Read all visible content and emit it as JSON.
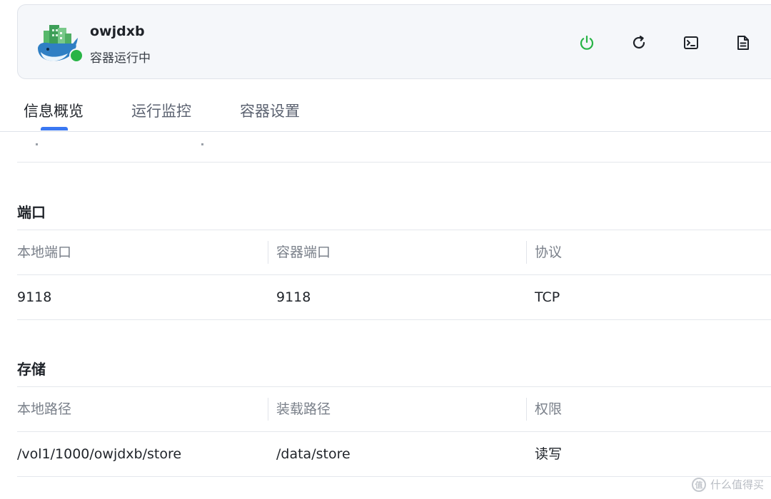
{
  "header": {
    "app_name": "owjdxb",
    "status_text": "容器运行中",
    "status_color": "#28b446",
    "actions": [
      {
        "name": "power-icon",
        "color": "#28b446"
      },
      {
        "name": "restart-icon",
        "color": "#1f2329"
      },
      {
        "name": "terminal-icon",
        "color": "#1f2329"
      },
      {
        "name": "log-document-icon",
        "color": "#1f2329"
      }
    ]
  },
  "tabs": [
    {
      "label": "信息概览",
      "active": true
    },
    {
      "label": "运行监控",
      "active": false
    },
    {
      "label": "容器设置",
      "active": false
    }
  ],
  "accent_color": "#3a78f2",
  "ports": {
    "title": "端口",
    "columns": [
      "本地端口",
      "容器端口",
      "协议"
    ],
    "rows": [
      [
        "9118",
        "9118",
        "TCP"
      ]
    ]
  },
  "storage": {
    "title": "存储",
    "columns": [
      "本地路径",
      "装载路径",
      "权限"
    ],
    "rows": [
      [
        "/vol1/1000/owjdxb/store",
        "/data/store",
        "读写"
      ]
    ]
  },
  "watermark": {
    "badge": "值",
    "text": "什么值得买"
  }
}
